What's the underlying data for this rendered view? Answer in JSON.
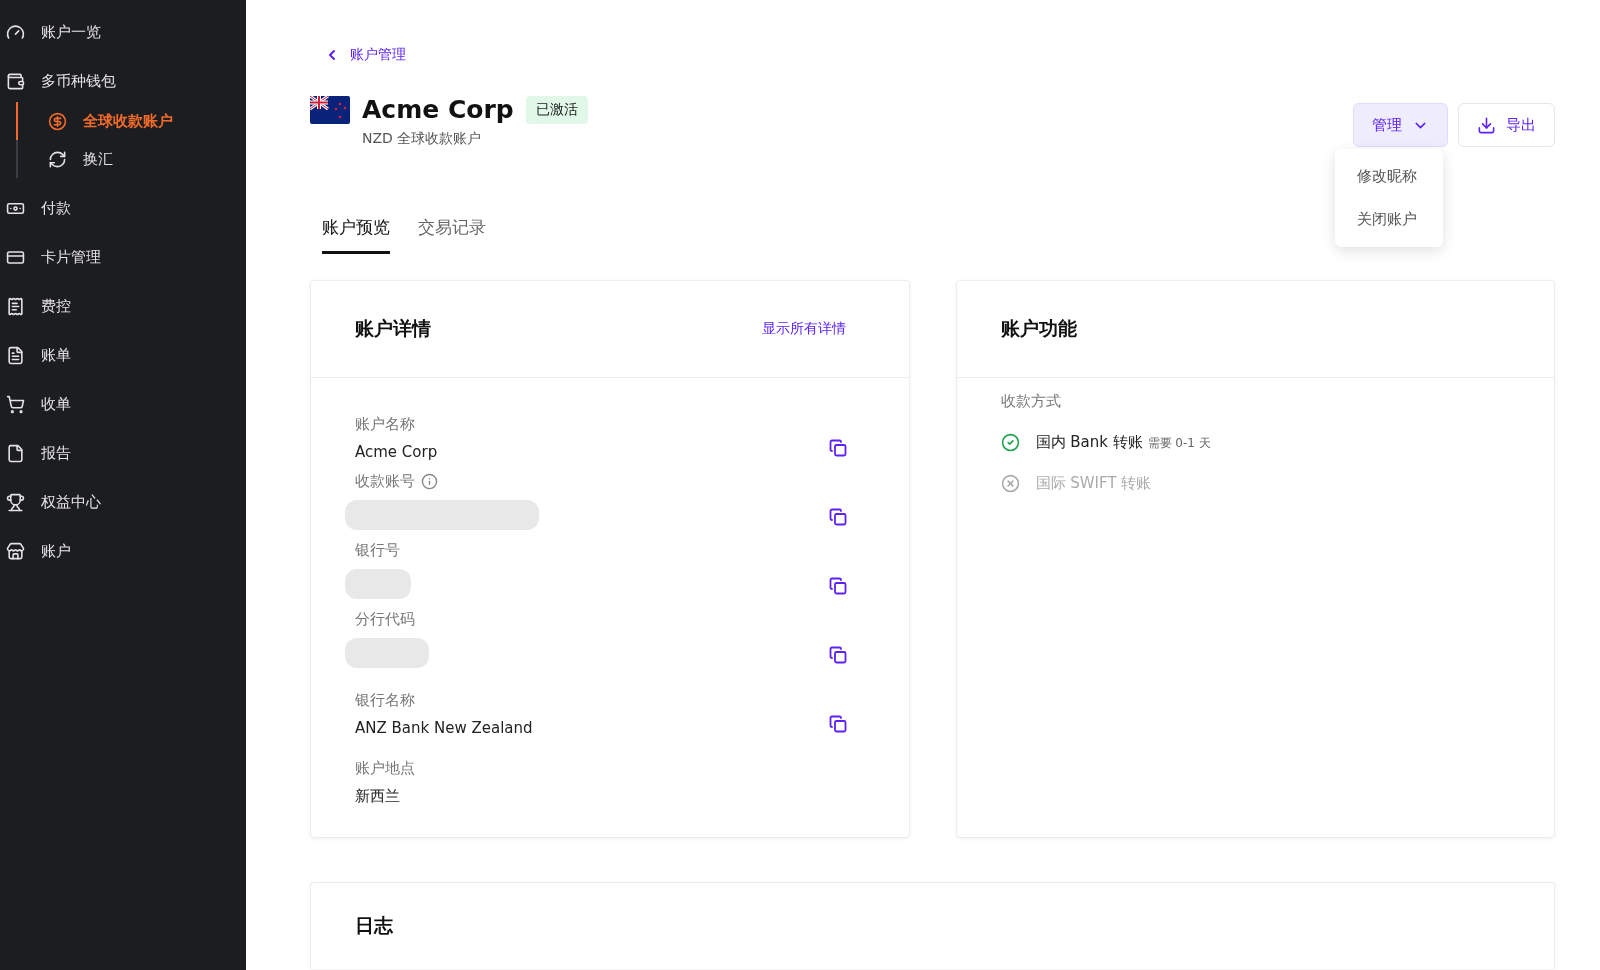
{
  "sidebar": {
    "items": [
      {
        "label": "账户一览",
        "selected": false
      },
      {
        "label": "多币种钱包",
        "selected": false,
        "children": [
          {
            "label": "全球收款账户",
            "selected": true
          },
          {
            "label": "换汇",
            "selected": false
          }
        ]
      },
      {
        "label": "付款",
        "selected": false
      },
      {
        "label": "卡片管理",
        "selected": false
      },
      {
        "label": "费控",
        "selected": false
      },
      {
        "label": "账单",
        "selected": false
      },
      {
        "label": "收单",
        "selected": false
      },
      {
        "label": "报告",
        "selected": false
      },
      {
        "label": "权益中心",
        "selected": false
      },
      {
        "label": "账户",
        "selected": false
      }
    ]
  },
  "back_link": "账户管理",
  "header": {
    "title": "Acme Corp",
    "status": "已激活",
    "subtitle": "NZD 全球收款账户"
  },
  "actions": {
    "manage": {
      "label": "管理",
      "open": true,
      "menu": [
        "修改昵称",
        "关闭账户"
      ]
    },
    "export": "导出"
  },
  "tabs": [
    {
      "label": "账户预览",
      "selected": true
    },
    {
      "label": "交易记录",
      "selected": false
    }
  ],
  "details": {
    "title": "账户详情",
    "link": "显示所有详情",
    "fields": [
      {
        "label": "账户名称",
        "value": "Acme Corp",
        "info": false,
        "masked": false,
        "copyable": true
      },
      {
        "label": "收款账号",
        "info": true,
        "masked": true,
        "copyable": true
      },
      {
        "label": "银行号",
        "info": false,
        "masked": true,
        "copyable": true
      },
      {
        "label": "分行代码",
        "info": false,
        "masked": true,
        "copyable": true
      },
      {
        "label": "银行名称",
        "value": "ANZ Bank New Zealand",
        "info": false,
        "masked": false,
        "copyable": true
      },
      {
        "label": "账户地点",
        "value": "新西兰",
        "info": false,
        "masked": false,
        "copyable": false
      }
    ]
  },
  "features": {
    "title": "账户功能",
    "section": "收款方式",
    "methods": [
      {
        "name": "国内 Bank 转账",
        "note": "需要 0-1 天",
        "enabled": true
      },
      {
        "name": "国际 SWIFT 转账",
        "enabled": false
      }
    ]
  },
  "log": {
    "title": "日志"
  }
}
